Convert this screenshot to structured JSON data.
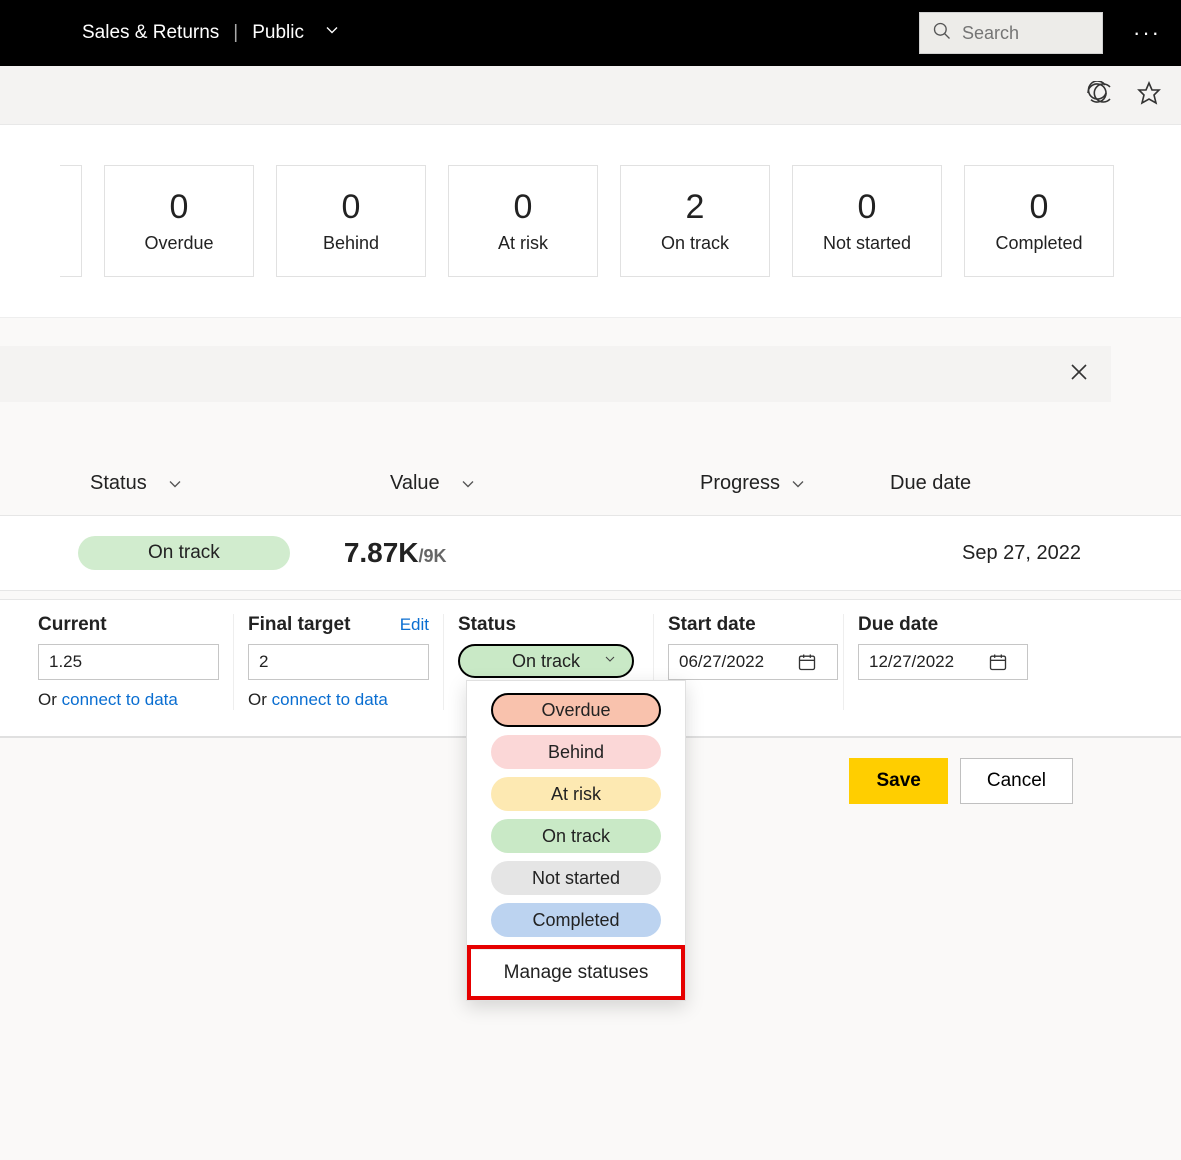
{
  "header": {
    "breadcrumb_1": "Sales & Returns",
    "breadcrumb_2": "Public",
    "search_placeholder": "Search"
  },
  "cards": [
    {
      "value": "0",
      "label": "Overdue"
    },
    {
      "value": "0",
      "label": "Behind"
    },
    {
      "value": "0",
      "label": "At risk"
    },
    {
      "value": "2",
      "label": "On track"
    },
    {
      "value": "0",
      "label": "Not started"
    },
    {
      "value": "0",
      "label": "Completed"
    }
  ],
  "columns": {
    "status": "Status",
    "value": "Value",
    "progress": "Progress",
    "due": "Due date"
  },
  "row": {
    "status": "On track",
    "value": "7.87K",
    "target": "/9K",
    "due": "Sep 27, 2022"
  },
  "form": {
    "current_label": "Current",
    "current_value": "1.25",
    "target_label": "Final target",
    "target_value": "2",
    "edit_label": "Edit",
    "connect_prefix": "Or ",
    "connect_link": "connect to data",
    "status_label": "Status",
    "status_value": "On track",
    "start_label": "Start date",
    "start_value": "06/27/2022",
    "due_label": "Due date",
    "due_value": "12/27/2022"
  },
  "status_options": {
    "overdue": "Overdue",
    "behind": "Behind",
    "atrisk": "At risk",
    "ontrack": "On track",
    "notstarted": "Not started",
    "completed": "Completed",
    "manage": "Manage statuses"
  },
  "buttons": {
    "save": "Save",
    "cancel": "Cancel"
  }
}
